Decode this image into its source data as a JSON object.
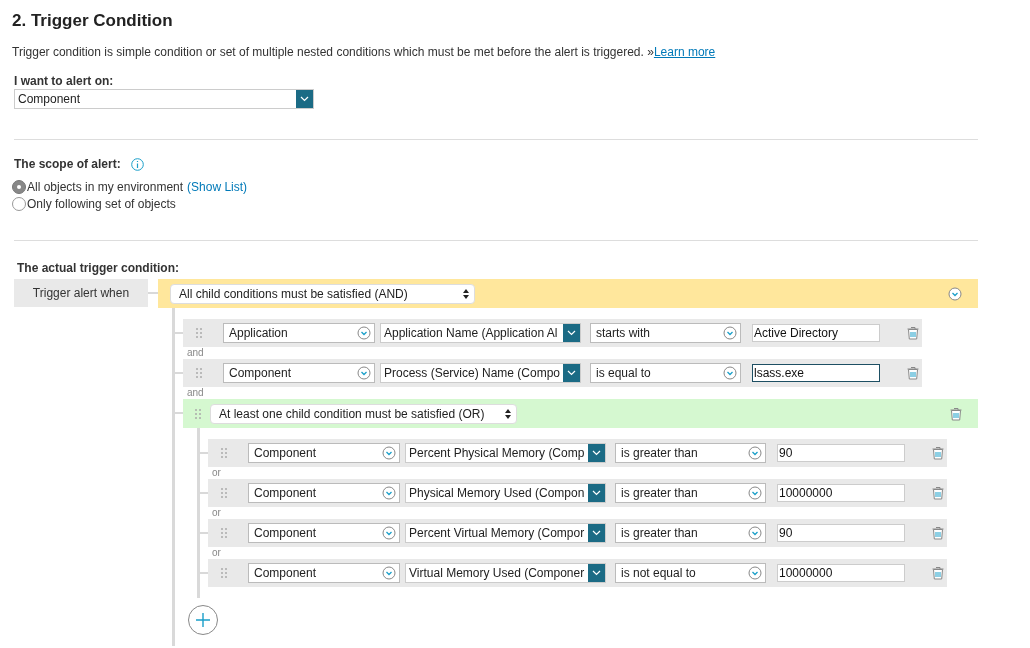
{
  "title": "2. Trigger Condition",
  "description": "Trigger condition is simple condition or set of multiple nested conditions which must be met before the alert is triggered. »",
  "learn_more": "Learn more",
  "alert_on": {
    "label": "I want to alert on:",
    "value": "Component"
  },
  "scope": {
    "label": "The scope of alert:",
    "options": [
      {
        "label": "All objects in my environment",
        "link": "(Show List)",
        "selected": true
      },
      {
        "label": "Only following set of objects",
        "selected": false
      }
    ]
  },
  "trigger": {
    "label": "The actual trigger condition:",
    "start_label": "Trigger alert when",
    "group": {
      "kind": "and-group",
      "operator": "All child conditions must be satisfied (AND)",
      "collapsible": true,
      "deletable": false,
      "draggable": false,
      "children": [
        {
          "kind": "condition",
          "entity": "Application",
          "field": "Application Name (Application Al",
          "operator": "starts with",
          "value": "Active Directory",
          "focused": false,
          "joiner": "and"
        },
        {
          "kind": "condition",
          "entity": "Component",
          "field": "Process (Service) Name (Compo",
          "operator": "is equal to",
          "value": "lsass.exe",
          "focused": true,
          "joiner": "and"
        },
        {
          "kind": "or-group",
          "operator": "At least one child condition must be satisfied (OR)",
          "collapsible": false,
          "deletable": true,
          "draggable": true,
          "can_add": true,
          "children": [
            {
              "kind": "condition",
              "entity": "Component",
              "field": "Percent Physical Memory (Comp",
              "operator": "is greater than",
              "value": "90",
              "focused": false,
              "joiner": "or"
            },
            {
              "kind": "condition",
              "entity": "Component",
              "field": "Physical Memory Used (Compon",
              "operator": "is greater than",
              "value": "10000000",
              "focused": false,
              "joiner": "or"
            },
            {
              "kind": "condition",
              "entity": "Component",
              "field": "Percent Virtual Memory (Compor",
              "operator": "is greater than",
              "value": "90",
              "focused": false,
              "joiner": "or"
            },
            {
              "kind": "condition",
              "entity": "Component",
              "field": "Virtual Memory Used (Componer",
              "operator": "is not equal to",
              "value": "10000000",
              "focused": false
            }
          ]
        }
      ]
    }
  }
}
